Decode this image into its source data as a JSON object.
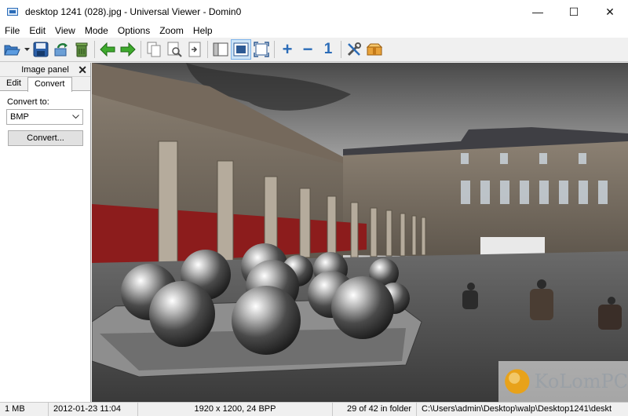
{
  "window": {
    "title": "desktop 1241 (028).jpg - Universal Viewer - Domin0",
    "minimize": "—",
    "maximize": "☐",
    "close": "✕"
  },
  "menu": [
    "File",
    "Edit",
    "View",
    "Mode",
    "Options",
    "Zoom",
    "Help"
  ],
  "toolbar": {
    "icons": [
      "open-folder-icon",
      "save-icon",
      "rotate-icon",
      "recycle-icon",
      "arrow-left-icon",
      "arrow-right-icon",
      "copy-icon",
      "find-icon",
      "goto-icon",
      "panel-icon",
      "fit-window-icon",
      "fullscreen-icon",
      "zoom-in-icon",
      "zoom-out-icon",
      "zoom-actual-icon",
      "tools-icon",
      "package-icon"
    ],
    "zoom_in": "+",
    "zoom_out": "−",
    "actual_size": "1"
  },
  "panel": {
    "title": "Image panel",
    "close": "✕",
    "tabs": [
      "Edit",
      "Convert"
    ],
    "active_tab": "Convert",
    "convert_to_label": "Convert to:",
    "format_value": "BMP",
    "convert_button": "Convert..."
  },
  "status": {
    "size": "1 MB",
    "date": "2012-01-23 11:04",
    "dimensions": "1920 x 1200, 24 BPP",
    "position": "29 of 42 in folder",
    "path": "C:\\Users\\admin\\Desktop\\walp\\Desktop1241\\deskt"
  },
  "watermark": "KoLomPC",
  "colors": {
    "accent": "#2b6cb8",
    "toolbar_active_bg": "#cde4f7"
  }
}
